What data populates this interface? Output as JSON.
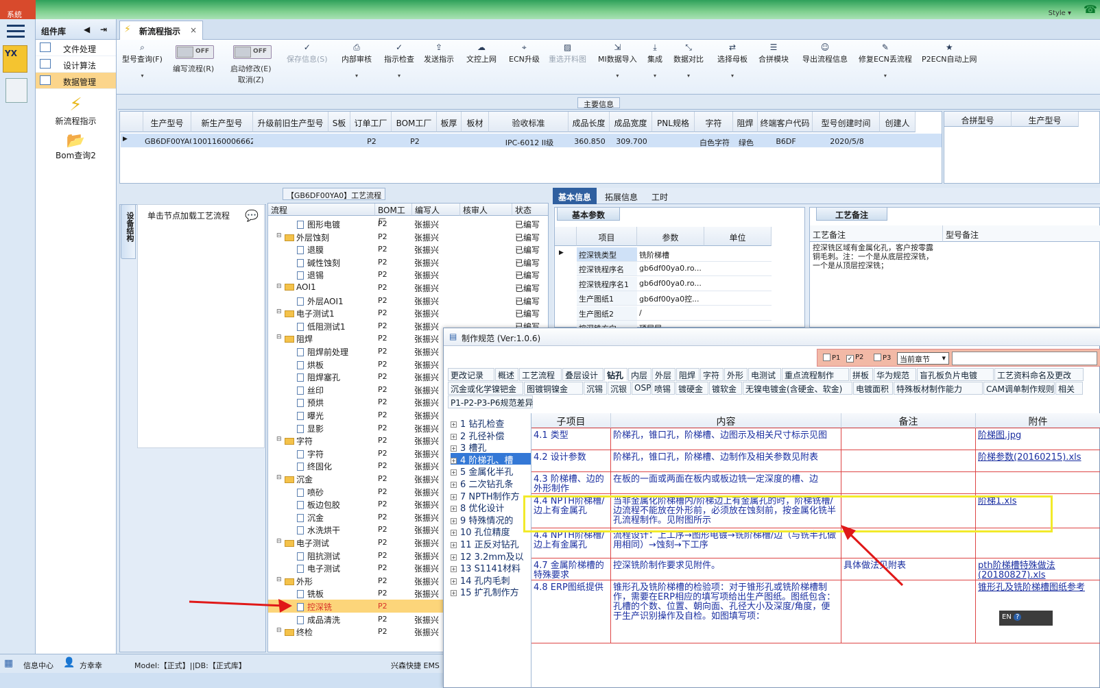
{
  "window": {
    "sys_label": "系統",
    "style_label": "Style"
  },
  "leftbar": {
    "yx_label": "YX"
  },
  "complib": {
    "title": "组件库",
    "items": [
      {
        "label": "文件处理"
      },
      {
        "label": "设计算法"
      },
      {
        "label": "数据管理"
      }
    ],
    "big": [
      {
        "label": "新流程指示"
      },
      {
        "label": "Bom查询2"
      }
    ]
  },
  "tab": {
    "label": "新流程指示",
    "close": "×"
  },
  "toolbar": {
    "items": [
      {
        "label": "型号查询(F)",
        "icon": "search"
      },
      {
        "label": "编写流程(R)",
        "toggle": "OFF"
      },
      {
        "label": "启动修改(E)",
        "label2": "取消(Z)",
        "toggle": "OFF"
      },
      {
        "label": "保存信息(S)",
        "icon": "check"
      },
      {
        "label": "内部审核",
        "icon": "print"
      },
      {
        "label": "指示检查",
        "icon": "check"
      },
      {
        "label": "发送指示",
        "icon": "upload"
      },
      {
        "label": "文控上网",
        "icon": "cloud"
      },
      {
        "label": "ECN升级",
        "icon": "binoculars"
      },
      {
        "label": "重选开料图",
        "icon": "image"
      },
      {
        "label": "MI数据导入",
        "icon": "import"
      },
      {
        "label": "集成",
        "icon": "download"
      },
      {
        "label": "数据对比",
        "icon": "compress"
      },
      {
        "label": "选择母板",
        "icon": "shuffle"
      },
      {
        "label": "合拼模块",
        "icon": "list"
      },
      {
        "label": "导出流程信息",
        "icon": "smile"
      },
      {
        "label": "修复ECN丢流程",
        "icon": "wrench"
      },
      {
        "label": "P2ECN自动上网",
        "icon": "star"
      }
    ]
  },
  "main_info": {
    "label": "主要信息",
    "headers": [
      "生产型号",
      "新生产型号",
      "升级前旧生产型号",
      "S板",
      "订单工厂",
      "BOM工厂",
      "板厚",
      "板材",
      "验收标准",
      "成品长度",
      "成品宽度",
      "PNL规格",
      "字符",
      "阻焊",
      "终端客户代码",
      "型号创建时间",
      "创建人"
    ],
    "row": [
      "GB6DF00YA0",
      "10011600066629",
      "",
      "",
      "P2",
      "P2",
      "",
      "",
      "IPC-6012 II级",
      "360.850",
      "309.700",
      "",
      "白色字符",
      "绿色",
      "B6DF",
      "2020/5/8",
      ""
    ],
    "right_headers": [
      "合拼型号",
      "生产型号"
    ]
  },
  "process": {
    "header": "【GB6DF00YA0】工艺流程",
    "vtab": "设备结构",
    "hint": "单击节点加载工艺流程",
    "cols": [
      "流程",
      "BOM工厂",
      "编写人",
      "核审人",
      "状态"
    ],
    "rows": [
      {
        "name": "图形电镀",
        "type": "doc",
        "lvl": 2,
        "bom": "P2",
        "wr": "张振兴",
        "st": "已编写"
      },
      {
        "name": "外层蚀刻",
        "type": "fold",
        "lvl": 1,
        "bom": "P2",
        "wr": "张振兴",
        "st": "已编写"
      },
      {
        "name": "退膜",
        "type": "doc",
        "lvl": 2,
        "bom": "P2",
        "wr": "张振兴",
        "st": "已编写"
      },
      {
        "name": "碱性蚀刻",
        "type": "doc",
        "lvl": 2,
        "bom": "P2",
        "wr": "张振兴",
        "st": "已编写"
      },
      {
        "name": "退锡",
        "type": "doc",
        "lvl": 2,
        "bom": "P2",
        "wr": "张振兴",
        "st": "已编写"
      },
      {
        "name": "AOI1",
        "type": "fold",
        "lvl": 1,
        "bom": "P2",
        "wr": "张振兴",
        "st": "已编写"
      },
      {
        "name": "外层AOI1",
        "type": "doc",
        "lvl": 2,
        "bom": "P2",
        "wr": "张振兴",
        "st": "已编写"
      },
      {
        "name": "电子测试1",
        "type": "fold",
        "lvl": 1,
        "bom": "P2",
        "wr": "张振兴",
        "st": "已编写"
      },
      {
        "name": "低阻测试1",
        "type": "doc",
        "lvl": 2,
        "bom": "P2",
        "wr": "张振兴",
        "st": "已编写"
      },
      {
        "name": "阻焊",
        "type": "fold",
        "lvl": 1,
        "bom": "P2",
        "wr": "张振兴",
        "st": "已编写"
      },
      {
        "name": "阻焊前处理",
        "type": "doc",
        "lvl": 2,
        "bom": "P2",
        "wr": "张振兴",
        "st": "已编写"
      },
      {
        "name": "烘板",
        "type": "doc",
        "lvl": 2,
        "bom": "P2",
        "wr": "张振兴",
        "st": "已编写"
      },
      {
        "name": "阻焊塞孔",
        "type": "doc",
        "lvl": 2,
        "bom": "P2",
        "wr": "张振兴",
        "st": "已编写"
      },
      {
        "name": "丝印",
        "type": "doc",
        "lvl": 2,
        "bom": "P2",
        "wr": "张振兴",
        "st": "已编写"
      },
      {
        "name": "预烘",
        "type": "doc",
        "lvl": 2,
        "bom": "P2",
        "wr": "张振兴",
        "st": "已编写"
      },
      {
        "name": "曝光",
        "type": "doc",
        "lvl": 2,
        "bom": "P2",
        "wr": "张振兴",
        "st": "已编写"
      },
      {
        "name": "显影",
        "type": "doc",
        "lvl": 2,
        "bom": "P2",
        "wr": "张振兴",
        "st": "已编写"
      },
      {
        "name": "字符",
        "type": "fold",
        "lvl": 1,
        "bom": "P2",
        "wr": "张振兴",
        "st": "已编写"
      },
      {
        "name": "字符",
        "type": "doc",
        "lvl": 2,
        "bom": "P2",
        "wr": "张振兴",
        "st": "已编写"
      },
      {
        "name": "终固化",
        "type": "doc",
        "lvl": 2,
        "bom": "P2",
        "wr": "张振兴",
        "st": "已编写"
      },
      {
        "name": "沉金",
        "type": "fold",
        "lvl": 1,
        "bom": "P2",
        "wr": "张振兴",
        "st": "已编写"
      },
      {
        "name": "喷砂",
        "type": "doc",
        "lvl": 2,
        "bom": "P2",
        "wr": "张振兴",
        "st": "已编写"
      },
      {
        "name": "板边包胶",
        "type": "doc",
        "lvl": 2,
        "bom": "P2",
        "wr": "张振兴",
        "st": "已编写"
      },
      {
        "name": "沉金",
        "type": "doc",
        "lvl": 2,
        "bom": "P2",
        "wr": "张振兴",
        "st": "已编写"
      },
      {
        "name": "水洗烘干",
        "type": "doc",
        "lvl": 2,
        "bom": "P2",
        "wr": "张振兴",
        "st": "已编写"
      },
      {
        "name": "电子测试",
        "type": "fold",
        "lvl": 1,
        "bom": "P2",
        "wr": "张振兴",
        "st": "已编写"
      },
      {
        "name": "阻抗测试",
        "type": "doc",
        "lvl": 2,
        "bom": "P2",
        "wr": "张振兴",
        "st": "已编写"
      },
      {
        "name": "电子测试",
        "type": "doc",
        "lvl": 2,
        "bom": "P2",
        "wr": "张振兴",
        "st": "已编写"
      },
      {
        "name": "外形",
        "type": "fold",
        "lvl": 1,
        "bom": "P2",
        "wr": "张振兴",
        "st": "已编写"
      },
      {
        "name": "铣板",
        "type": "doc",
        "lvl": 2,
        "bom": "P2",
        "wr": "张振兴",
        "st": "已编写"
      },
      {
        "name": "控深铣",
        "type": "doc",
        "lvl": 2,
        "bom": "P2",
        "wr": "",
        "st": "",
        "hl": true
      },
      {
        "name": "成品清洗",
        "type": "doc",
        "lvl": 2,
        "bom": "P2",
        "wr": "张振兴",
        "st": "已编写"
      },
      {
        "name": "终检",
        "type": "fold",
        "lvl": 1,
        "bom": "P2",
        "wr": "张振兴",
        "st": "已编写"
      }
    ]
  },
  "right_panel": {
    "tabs": [
      "基本信息",
      "拓展信息",
      "工时"
    ],
    "basic_title": "基本参数",
    "cols": [
      "项目",
      "参数",
      "单位"
    ],
    "rows": [
      [
        "控深铣类型",
        "铣阶梯槽",
        ""
      ],
      [
        "控深铣程序名",
        "gb6df00ya0.ro...",
        ""
      ],
      [
        "控深铣程序名1",
        "gb6df00ya0.ro...",
        ""
      ],
      [
        "生产图纸1",
        "gb6df00ya0控...",
        ""
      ],
      [
        "生产图纸2",
        "/",
        ""
      ],
      [
        "控深铣方向",
        "顶层层",
        ""
      ]
    ],
    "gongyi_title": "工艺备注",
    "gcols": [
      "工艺备注",
      "型号备注"
    ],
    "gtext": "控深铣区域有金属化孔，客户按零露铜毛刺。注：一个是从底层控深铣，一个是从顶层控深铣；"
  },
  "dialog": {
    "title": "制作规范 (Ver:1.0.6)",
    "filter": {
      "p1": "P1",
      "p2": "P2",
      "p3": "P3",
      "select": "当前章节"
    },
    "tabs_row1": [
      "更改记录",
      "概述",
      "工艺流程",
      "叠层设计",
      "钻孔",
      "内层",
      "外层",
      "阻焊",
      "字符",
      "外形",
      "电测试",
      "重点流程制作",
      "拼板",
      "华为规范",
      "盲孔板负片电镀",
      "工艺资料命名及更改"
    ],
    "tabs_row2": [
      "沉金或化学镍钯金",
      "图镀铜镍金",
      "沉锡",
      "沉银",
      "OSP",
      "喷锡",
      "镀硬金",
      "镀软金",
      "无镍电镀金(含硬金、软金)",
      "电镀面积",
      "特殊板材制作能力",
      "CAM调单制作规则",
      "相关"
    ],
    "tabs_row3": [
      "P1-P2-P3-P6规范差异"
    ],
    "toc": [
      "1 钻孔检查",
      "2 孔径补偿",
      "3 槽孔",
      "4 阶梯孔、槽",
      "5 金属化半孔",
      "6 二次钻孔条",
      "7 NPTH制作方",
      "8 优化设计",
      "9 特殊情况的",
      "10 孔位精度",
      "11 正反对钻孔",
      "12 3.2mm及以",
      "13 S1141材料",
      "14 孔内毛刺",
      "15 扩孔制作方"
    ],
    "cols": [
      "子项目",
      "内容",
      "备注",
      "附件"
    ],
    "rows": [
      {
        "sub": "4.1 类型",
        "content": "阶梯孔，锥口孔，阶梯槽、边图示及相关尺寸标示见图",
        "note": "",
        "att": "阶梯图.jpg"
      },
      {
        "sub": "4.2 设计参数",
        "content": "阶梯孔，锥口孔，阶梯槽、边制作及相关参数见附表",
        "note": "",
        "att": "阶梯参数(20160215).xls"
      },
      {
        "sub": "4.3 阶梯槽、边的外形制作",
        "content": "在板的一面或两面在板内或板边铣一定深度的槽、边",
        "note": "",
        "att": ""
      },
      {
        "sub": "4.4 NPTH阶梯槽/边上有金属孔",
        "content": "当非金属化阶梯槽内/阶梯边上有金属孔的时，阶梯铣槽/边流程不能放在外形前，必须放在蚀刻前，按金属化铣半孔流程制作。见附图所示",
        "note": "",
        "att": "阶梯1.xls"
      },
      {
        "sub": "4.4 NPTH阶梯槽/边上有金属孔",
        "content": "流程设计：上工序→图形电镀→铣阶梯槽/边（与铣半孔做用相同）→蚀刻→下工序",
        "note": "",
        "att": ""
      },
      {
        "sub": "4.7 金属阶梯槽的特殊要求",
        "content": "控深铣阶制作要求见附件。",
        "note": "具体做法见附表",
        "att": "pth阶梯槽特殊做法(20180827).xls"
      },
      {
        "sub": "4.8 ERP图纸提供",
        "content": "锥形孔及铣阶梯槽的检验项：对于锥形孔或铣阶梯槽制作，需要在ERP相应的填写项给出生产图纸。图纸包含：孔槽的个数、位置、朝向面、孔径大小及深度/角度，便于生产识别操作及自检。如图填写项：",
        "note": "",
        "att": "锥形孔及铣阶梯槽图纸参考"
      }
    ],
    "ime": "EN"
  },
  "status": {
    "info": "信息中心",
    "user": "方幸幸",
    "model": "Model:【正式】||DB:【正式库】",
    "brand": "兴森快捷 EMS"
  }
}
